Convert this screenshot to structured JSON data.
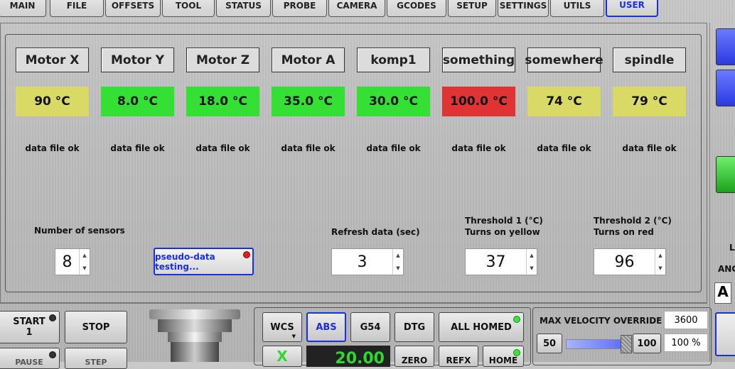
{
  "tabs": [
    {
      "label": "MAIN",
      "active": false
    },
    {
      "label": "FILE",
      "active": false
    },
    {
      "label": "OFFSETS",
      "active": false
    },
    {
      "label": "TOOL",
      "active": false
    },
    {
      "label": "STATUS",
      "active": false
    },
    {
      "label": "PROBE",
      "active": false
    },
    {
      "label": "CAMERA",
      "active": false
    },
    {
      "label": "GCODES",
      "active": false
    },
    {
      "label": "SETUP",
      "active": false
    },
    {
      "label": "SETTINGS",
      "active": false
    },
    {
      "label": "UTILS",
      "active": false
    },
    {
      "label": "USER",
      "active": true
    }
  ],
  "sensors": [
    {
      "name": "Motor X",
      "temp": "90 °C",
      "status": "data file ok",
      "color": "#d9d966"
    },
    {
      "name": "Motor Y",
      "temp": "8.0 °C",
      "status": "data file ok",
      "color": "#33e033"
    },
    {
      "name": "Motor Z",
      "temp": "18.0 °C",
      "status": "data file ok",
      "color": "#33e033"
    },
    {
      "name": "Motor A",
      "temp": "35.0 °C",
      "status": "data file ok",
      "color": "#33e033"
    },
    {
      "name": "komp1",
      "temp": "30.0 °C",
      "status": "data file ok",
      "color": "#33e033"
    },
    {
      "name": "something",
      "temp": "100.0 °C",
      "status": "data file ok",
      "color": "#e03333"
    },
    {
      "name": "somewhere",
      "temp": "74 °C",
      "status": "data file ok",
      "color": "#d9d966"
    },
    {
      "name": "spindle",
      "temp": "79 °C",
      "status": "data file ok",
      "color": "#d9d966"
    }
  ],
  "controls": {
    "num_sensors_label": "Number of sensors",
    "num_sensors_value": "8",
    "pseudo_button": "pseudo-data testing...",
    "refresh_label": "Refresh data (sec)",
    "refresh_value": "3",
    "threshold1_label_a": "Threshold 1 (°C)",
    "threshold1_label_b": "Turns on yellow",
    "threshold1_value": "37",
    "threshold2_label_a": "Threshold 2 (°C)",
    "threshold2_label_b": "Turns on red",
    "threshold2_value": "96"
  },
  "bottom": {
    "start": "START\n1",
    "stop": "STOP",
    "pause": "PAUSE",
    "step": "STEP",
    "wcs": "WCS",
    "abs": "ABS",
    "g54": "G54",
    "dtg": "DTG",
    "all_homed": "ALL HOMED",
    "axis_x": "X",
    "axis_value": "20.00",
    "zero": "ZERO",
    "refx": "REFX",
    "home": "HOME",
    "max_vel_label": "MAX VELOCITY OVERRIDE",
    "max_vel_value": "3600",
    "btn_50": "50",
    "btn_100": "100",
    "percent": "100 %",
    "slider_fraction": 1.0
  },
  "right": {
    "l_label": "L",
    "ang_label": "ANG",
    "a_label": "A"
  },
  "colors": {
    "accent": "#1a2fe0",
    "ok": "#33e033",
    "warn": "#d9d966",
    "alarm": "#e03333"
  }
}
